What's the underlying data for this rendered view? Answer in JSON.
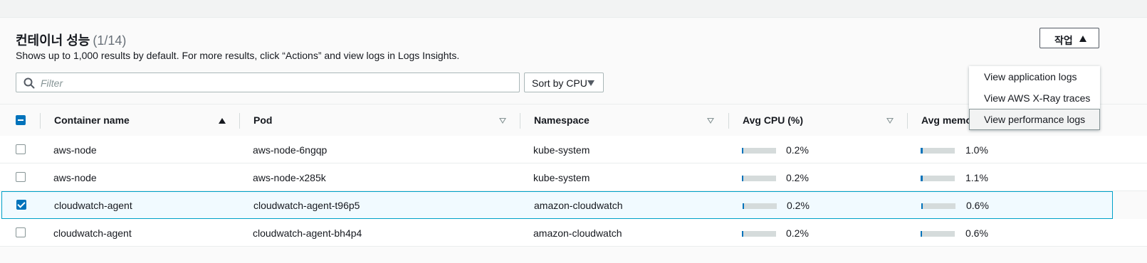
{
  "panel": {
    "title": "컨테이너 성능",
    "count": "(1/14)",
    "description": "Shows up to 1,000 results by default. For more results, click “Actions” and view logs in Logs Insights."
  },
  "filter": {
    "placeholder": "Filter"
  },
  "sort": {
    "label": "Sort by CPU"
  },
  "actions": {
    "label": "작업",
    "menu": [
      {
        "label": "View application logs"
      },
      {
        "label": "View AWS X-Ray traces"
      },
      {
        "label": "View performance logs"
      }
    ]
  },
  "table": {
    "columns": [
      "Container name",
      "Pod",
      "Namespace",
      "Avg CPU (%)",
      "Avg memory (%)"
    ],
    "rows": [
      {
        "container": "aws-node",
        "pod": "aws-node-6ngqp",
        "namespace": "kube-system",
        "cpu": "0.2%",
        "cpu_value": 0.2,
        "memory": "1.0%",
        "memory_value": 1.0,
        "selected": false
      },
      {
        "container": "aws-node",
        "pod": "aws-node-x285k",
        "namespace": "kube-system",
        "cpu": "0.2%",
        "cpu_value": 0.2,
        "memory": "1.1%",
        "memory_value": 1.1,
        "selected": false
      },
      {
        "container": "cloudwatch-agent",
        "pod": "cloudwatch-agent-t96p5",
        "namespace": "amazon-cloudwatch",
        "cpu": "0.2%",
        "cpu_value": 0.2,
        "memory": "0.6%",
        "memory_value": 0.6,
        "selected": true
      },
      {
        "container": "cloudwatch-agent",
        "pod": "cloudwatch-agent-bh4p4",
        "namespace": "amazon-cloudwatch",
        "cpu": "0.2%",
        "cpu_value": 0.2,
        "memory": "0.6%",
        "memory_value": 0.6,
        "selected": false
      }
    ]
  },
  "colors": {
    "accent": "#0073bb",
    "selected_row_bg": "#f1faff",
    "selected_row_border": "#00a1c9"
  }
}
